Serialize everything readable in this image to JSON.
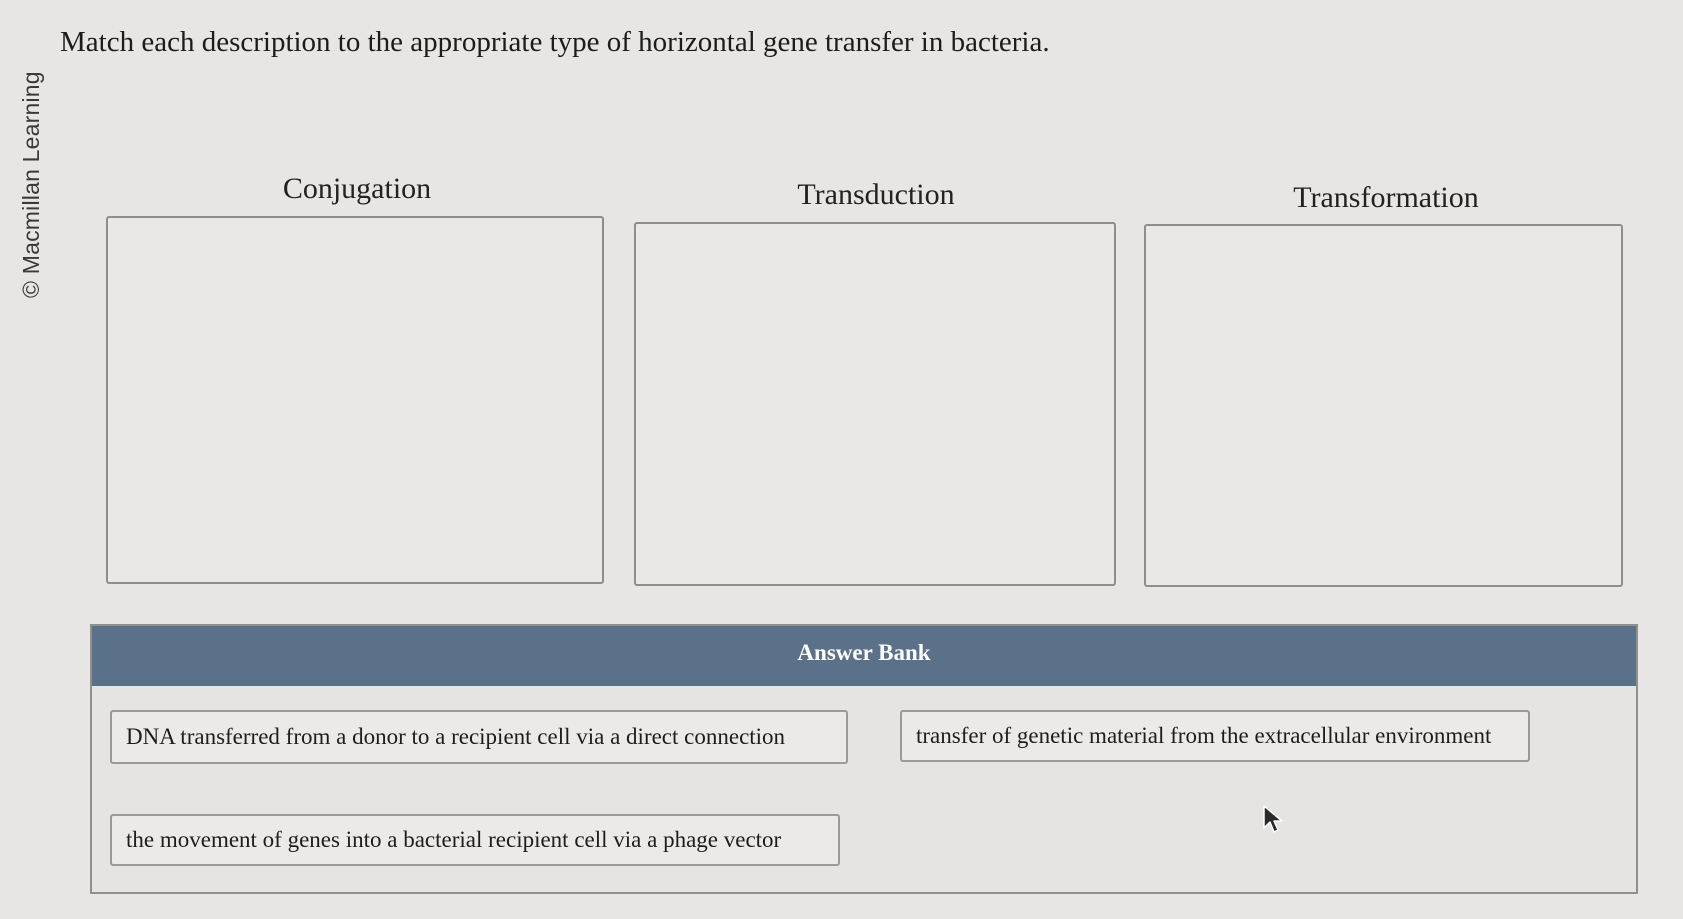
{
  "copyright": "© Macmillan Learning",
  "question": "Match each description to the appropriate type of horizontal gene transfer in bacteria.",
  "targets": [
    {
      "label": "Conjugation"
    },
    {
      "label": "Transduction"
    },
    {
      "label": "Transformation"
    }
  ],
  "answer_bank": {
    "title": "Answer Bank",
    "items": [
      "DNA transferred from a donor to a recipient cell via a direct connection",
      "transfer of genetic material from the extracellular environment",
      "the movement of genes into a bacterial recipient cell via a phage vector"
    ]
  },
  "colors": {
    "background": "#e7e6e4",
    "bank_header": "#5b7189",
    "border": "#8e8e8e"
  },
  "icons": {
    "pointer": "mouse-pointer-icon"
  }
}
